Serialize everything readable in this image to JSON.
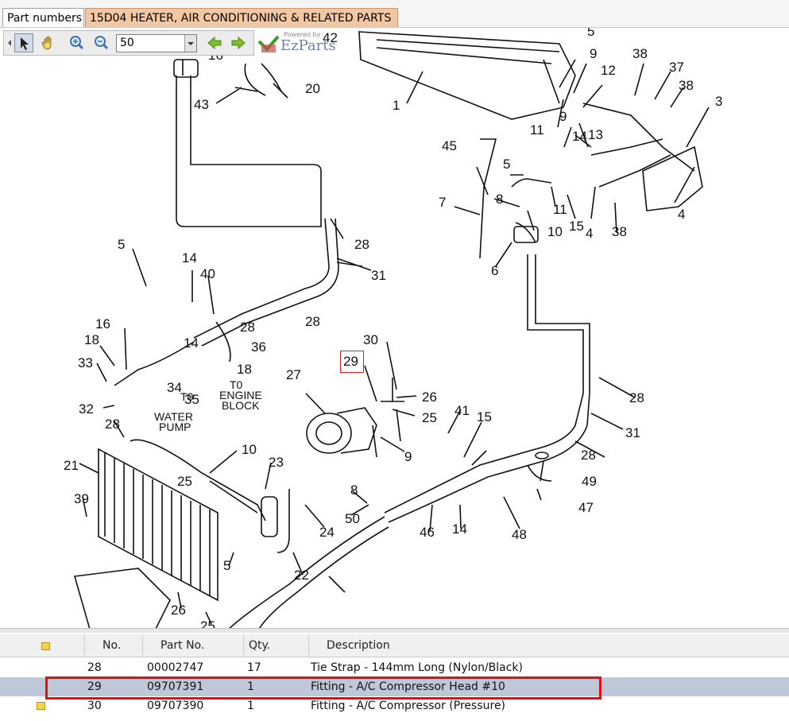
{
  "tabs": [
    {
      "label": "Part numbers",
      "active": true
    },
    {
      "label": "15D04 HEATER, AIR CONDITIONING & RELATED PARTS",
      "active": false
    }
  ],
  "toolbar": {
    "zoom_value": "50",
    "logo_small": "Powered by",
    "logo_text": "EzParts",
    "icons": [
      "pointer-icon",
      "pan-hand-icon",
      "zoom-in-icon",
      "zoom-out-icon",
      "arrow-left-icon",
      "arrow-right-icon"
    ]
  },
  "diagram": {
    "highlighted_callout": "29",
    "callouts": [
      "42",
      "5",
      "9",
      "38",
      "37",
      "38",
      "3",
      "16",
      "20",
      "43",
      "1",
      "12",
      "11",
      "9",
      "13",
      "14",
      "45",
      "5",
      "4",
      "7",
      "8",
      "11",
      "15",
      "4",
      "38",
      "10",
      "6",
      "28",
      "31",
      "5",
      "14",
      "40",
      "16",
      "18",
      "33",
      "32",
      "28",
      "31",
      "14",
      "36",
      "18",
      "34",
      "35",
      "28",
      "29",
      "30",
      "26",
      "25",
      "27",
      "9",
      "28",
      "41",
      "15",
      "31",
      "21",
      "10",
      "23",
      "39",
      "25",
      "8",
      "50",
      "24",
      "49",
      "47",
      "46",
      "14",
      "48",
      "5",
      "22",
      "26",
      "25"
    ],
    "text_labels": {
      "water_pump": [
        "T0",
        "WATER",
        "PUMP"
      ],
      "engine_block": [
        "T0",
        "ENGINE",
        "BLOCK"
      ]
    }
  },
  "table": {
    "columns": [
      "No.",
      "Part No.",
      "Qty.",
      "Description"
    ],
    "rows": [
      {
        "no": "28",
        "part_no": "00002747",
        "qty": "17",
        "description": "Tie Strap - 144mm Long (Nylon/Black)",
        "selected": false,
        "icon": false
      },
      {
        "no": "29",
        "part_no": "09707391",
        "qty": "1",
        "description": "Fitting - A/C Compressor Head #10",
        "selected": true,
        "icon": false
      },
      {
        "no": "30",
        "part_no": "09707390",
        "qty": "1",
        "description": "Fitting - A/C Compressor (Pressure)",
        "selected": false,
        "icon": true
      }
    ]
  },
  "colors": {
    "selected_row": "#bfc8d8",
    "selection_outline": "#e01010",
    "active_tab": "#ffffff",
    "other_tab": "#f2c7a1"
  }
}
